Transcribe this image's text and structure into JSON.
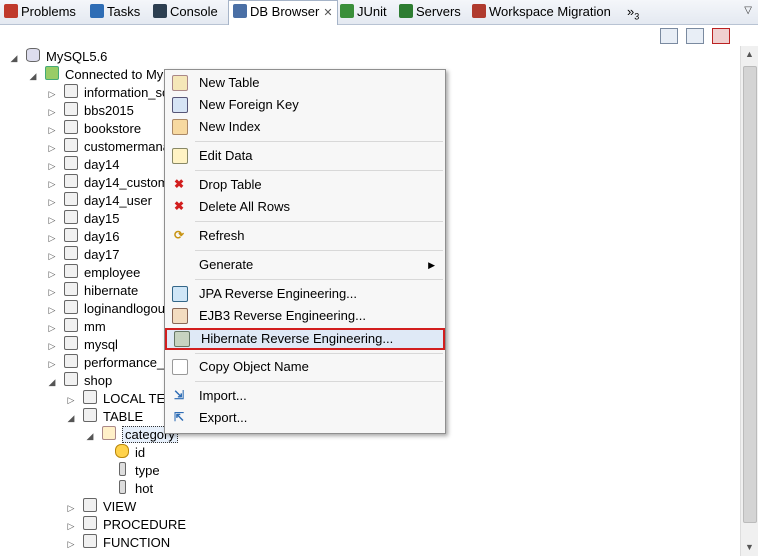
{
  "tabs": [
    {
      "label": "Problems",
      "icon": "problems-icon",
      "color": "#c0392b"
    },
    {
      "label": "Tasks",
      "icon": "tasks-icon",
      "color": "#2f6db5"
    },
    {
      "label": "Console",
      "icon": "console-icon",
      "color": "#2c3e50"
    },
    {
      "label": "DB Browser",
      "icon": "db-browser-icon",
      "color": "#4a6fa5",
      "active": true
    },
    {
      "label": "JUnit",
      "icon": "junit-icon",
      "color": "#3a8f3a"
    },
    {
      "label": "Servers",
      "icon": "servers-icon",
      "color": "#2e7d32"
    },
    {
      "label": "Workspace Migration",
      "icon": "workspace-migration-icon",
      "color": "#b03a2e"
    },
    {
      "label": "3",
      "icon": "overflow-chevron-icon",
      "color": "#333333"
    }
  ],
  "tree": {
    "root": "MySQL5.6",
    "connection": "Connected to My",
    "databases": [
      "information_sc",
      "bbs2015",
      "bookstore",
      "customermana",
      "day14",
      "day14_custom",
      "day14_user",
      "day15",
      "day16",
      "day17",
      "employee",
      "hibernate",
      "loginandlogou",
      "mm",
      "mysql",
      "performance_"
    ],
    "shop": {
      "label": "shop",
      "local_temp": "LOCAL TEM",
      "table": "TABLE",
      "category": "category",
      "columns": [
        "id",
        "type",
        "hot"
      ],
      "view": "VIEW",
      "procedure": "PROCEDURE",
      "function": "FUNCTION"
    }
  },
  "context_menu": {
    "items": [
      {
        "label": "New Table",
        "icon": "new-table-icon"
      },
      {
        "label": "New Foreign Key",
        "icon": "new-foreign-key-icon"
      },
      {
        "label": "New Index",
        "icon": "new-index-icon"
      },
      {
        "label": "Edit Data",
        "icon": "edit-data-icon"
      },
      {
        "label": "Drop Table",
        "icon": "drop-table-icon"
      },
      {
        "label": "Delete All Rows",
        "icon": "delete-all-rows-icon"
      },
      {
        "label": "Refresh",
        "icon": "refresh-icon"
      },
      {
        "label": "Generate",
        "icon": "",
        "submenu": true
      },
      {
        "label": "JPA Reverse Engineering...",
        "icon": "jpa-icon"
      },
      {
        "label": "EJB3 Reverse Engineering...",
        "icon": "ejb3-icon"
      },
      {
        "label": "Hibernate Reverse Engineering...",
        "icon": "hibernate-icon",
        "highlighted": true
      },
      {
        "label": "Copy Object Name",
        "icon": "copy-icon"
      },
      {
        "label": "Import...",
        "icon": "import-icon"
      },
      {
        "label": "Export...",
        "icon": "export-icon"
      }
    ],
    "highlight_color": "#d21e1e"
  }
}
